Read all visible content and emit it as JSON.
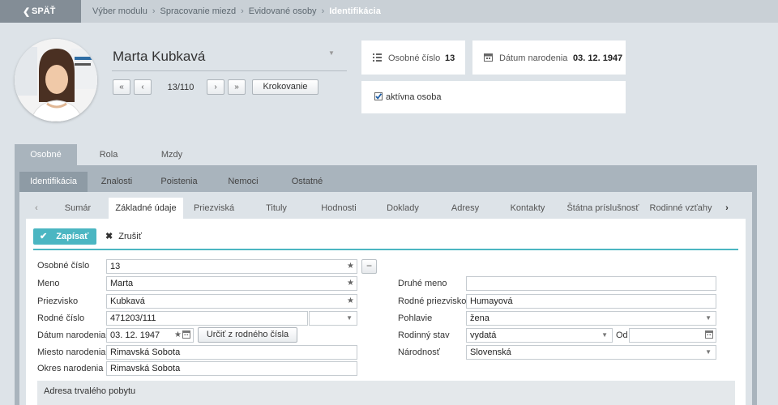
{
  "topbar": {
    "back_label": "SPÄŤ",
    "breadcrumbs": [
      "Výber modulu",
      "Spracovanie miezd",
      "Evidované osoby",
      "Identifikácia"
    ]
  },
  "person": {
    "name": "Marta Kubkavá",
    "counter": "13/110",
    "krokovanie_label": "Krokovanie"
  },
  "cards": {
    "osobne_cislo_label": "Osobné číslo",
    "osobne_cislo_value": "13",
    "datum_label": "Dátum narodenia",
    "datum_value": "03. 12. 1947",
    "active_label": "aktívna osoba"
  },
  "main_tabs": [
    "Osobné",
    "Rola",
    "Mzdy"
  ],
  "sub_tabs": [
    "Identifikácia",
    "Znalosti",
    "Poistenia",
    "Nemoci",
    "Ostatné"
  ],
  "detail_tabs": [
    "Sumár",
    "Základné údaje",
    "Priezviská",
    "Tituly",
    "Hodnosti",
    "Doklady",
    "Adresy",
    "Kontakty",
    "Štátna príslušnosť",
    "Rodinné vzťahy"
  ],
  "actions": {
    "save_label": "Zapísať",
    "cancel_label": "Zrušiť"
  },
  "form": {
    "osobne_cislo": {
      "label": "Osobné číslo",
      "value": "13"
    },
    "meno": {
      "label": "Meno",
      "value": "Marta"
    },
    "priezvisko": {
      "label": "Priezvisko",
      "value": "Kubkavá"
    },
    "rodne_cislo": {
      "label": "Rodné číslo",
      "value": "471203/111"
    },
    "datum_narodenia": {
      "label": "Dátum narodenia",
      "value": "03. 12. 1947",
      "button": "Určiť z rodného čísla"
    },
    "miesto_narodenia": {
      "label": "Miesto narodenia",
      "value": "Rimavská Sobota"
    },
    "okres_narodenia": {
      "label": "Okres narodenia",
      "value": "Rimavská Sobota"
    },
    "druhe_meno": {
      "label": "Druhé meno",
      "value": ""
    },
    "rodne_priezvisko": {
      "label": "Rodné priezvisko",
      "value": "Humayová"
    },
    "pohlavie": {
      "label": "Pohlavie",
      "value": "žena"
    },
    "rodinny_stav": {
      "label": "Rodinný stav",
      "value": "vydatá",
      "od_label": "Od"
    },
    "narodnost": {
      "label": "Národnosť",
      "value": "Slovenská"
    }
  },
  "address_section": "Adresa trvalého pobytu",
  "colors": {
    "accent": "#4bb6c2",
    "tab_active": "#a9b4bd",
    "topbar": "#c9d0d6",
    "back": "#838d96"
  }
}
